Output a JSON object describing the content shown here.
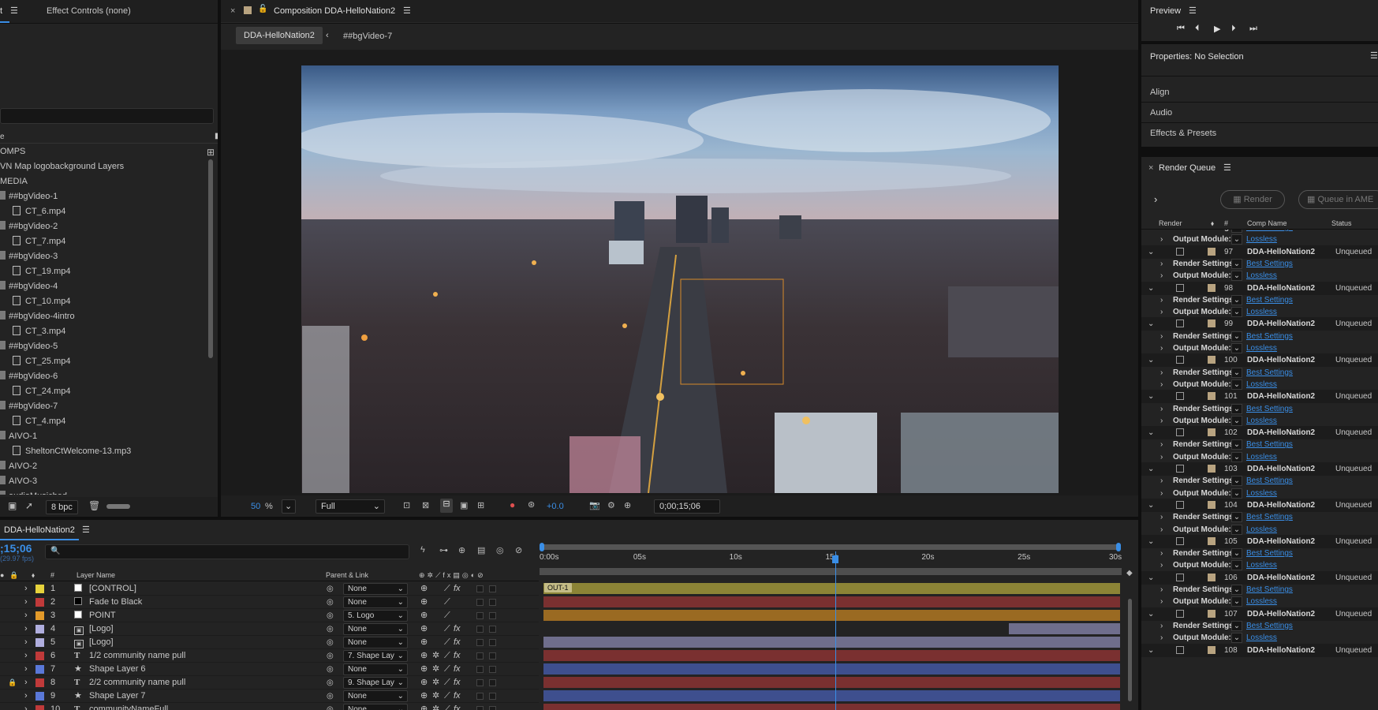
{
  "project": {
    "tab_project_suffix": "t",
    "tab_effect_controls": "Effect Controls (none)",
    "name_header": "e",
    "bpc": "8 bpc",
    "items": [
      {
        "label": "OMPS",
        "type": "folder",
        "indent": 0
      },
      {
        "label": "VN Map logobackground Layers",
        "type": "comp",
        "indent": 0
      },
      {
        "label": "MEDIA",
        "type": "folder",
        "indent": 0
      },
      {
        "label": "##bgVideo-1",
        "type": "folder",
        "indent": 1
      },
      {
        "label": "CT_6.mp4",
        "type": "file",
        "indent": 2
      },
      {
        "label": "##bgVideo-2",
        "type": "folder",
        "indent": 1
      },
      {
        "label": "CT_7.mp4",
        "type": "file",
        "indent": 2
      },
      {
        "label": "##bgVideo-3",
        "type": "folder",
        "indent": 1
      },
      {
        "label": "CT_19.mp4",
        "type": "file",
        "indent": 2
      },
      {
        "label": "##bgVideo-4",
        "type": "folder",
        "indent": 1
      },
      {
        "label": "CT_10.mp4",
        "type": "file",
        "indent": 2
      },
      {
        "label": "##bgVideo-4intro",
        "type": "folder",
        "indent": 1
      },
      {
        "label": "CT_3.mp4",
        "type": "file",
        "indent": 2
      },
      {
        "label": "##bgVideo-5",
        "type": "folder",
        "indent": 1
      },
      {
        "label": "CT_25.mp4",
        "type": "file",
        "indent": 2
      },
      {
        "label": "##bgVideo-6",
        "type": "folder",
        "indent": 1
      },
      {
        "label": "CT_24.mp4",
        "type": "file",
        "indent": 2
      },
      {
        "label": "##bgVideo-7",
        "type": "folder",
        "indent": 1
      },
      {
        "label": "CT_4.mp4",
        "type": "file",
        "indent": 2
      },
      {
        "label": "AIVO-1",
        "type": "folder",
        "indent": 1
      },
      {
        "label": "SheltonCtWelcome-13.mp3",
        "type": "file",
        "indent": 2
      },
      {
        "label": "AIVO-2",
        "type": "folder",
        "indent": 1
      },
      {
        "label": "AIVO-3",
        "type": "folder",
        "indent": 1
      },
      {
        "label": "audioMusicbed",
        "type": "folder",
        "indent": 1
      }
    ]
  },
  "composition": {
    "panel_title": "Composition DDA-HelloNation2",
    "breadcrumb_active": "DDA-HelloNation2",
    "breadcrumb_next": "##bgVideo-7",
    "zoom_value": "50",
    "zoom_unit": "%",
    "resolution": "Full",
    "exposure": "+0.0",
    "timecode": "0;00;15;06"
  },
  "preview": {
    "title": "Preview"
  },
  "properties": {
    "title": "Properties: No Selection",
    "sections": [
      "Align",
      "Audio",
      "Effects & Presets"
    ]
  },
  "render_queue": {
    "title": "Render Queue",
    "render_button": "Render",
    "queue_ame_button": "Queue in AME",
    "columns": {
      "render": "Render",
      "num": "#",
      "comp_name": "Comp Name",
      "status": "Status"
    },
    "render_settings_label": "Render Settings:",
    "output_module_label": "Output Module:",
    "render_settings_value": "Best Settings",
    "output_module_value": "Lossless",
    "items": [
      {
        "num": "97",
        "comp": "DDA-HelloNation2",
        "status": "Unqueued"
      },
      {
        "num": "98",
        "comp": "DDA-HelloNation2",
        "status": "Unqueued"
      },
      {
        "num": "99",
        "comp": "DDA-HelloNation2",
        "status": "Unqueued"
      },
      {
        "num": "100",
        "comp": "DDA-HelloNation2",
        "status": "Unqueued"
      },
      {
        "num": "101",
        "comp": "DDA-HelloNation2",
        "status": "Unqueued"
      },
      {
        "num": "102",
        "comp": "DDA-HelloNation2",
        "status": "Unqueued"
      },
      {
        "num": "103",
        "comp": "DDA-HelloNation2",
        "status": "Unqueued"
      },
      {
        "num": "104",
        "comp": "DDA-HelloNation2",
        "status": "Unqueued"
      },
      {
        "num": "105",
        "comp": "DDA-HelloNation2",
        "status": "Unqueued"
      },
      {
        "num": "106",
        "comp": "DDA-HelloNation2",
        "status": "Unqueued"
      },
      {
        "num": "107",
        "comp": "DDA-HelloNation2",
        "status": "Unqueued"
      },
      {
        "num": "108",
        "comp": "DDA-HelloNation2",
        "status": "Unqueued"
      }
    ]
  },
  "timeline": {
    "comp_tab": "DDA-HelloNation2",
    "timecode": ";15;06",
    "fps": "(29.97 fps)",
    "col_num": "#",
    "col_layer_name": "Layer Name",
    "col_parent": "Parent & Link",
    "ruler": [
      "0:00s",
      "05s",
      "10s",
      "15s",
      "20s",
      "25s",
      "30s"
    ],
    "marker": "OUT-1",
    "playhead_seconds": 15.2,
    "duration_seconds": 30,
    "layers": [
      {
        "num": "1",
        "name": "[CONTROL]",
        "label": "#e6d23c",
        "type": "solid-white",
        "parent": "None",
        "bar": "#8c8436",
        "start": 0,
        "end": 30
      },
      {
        "num": "2",
        "name": "Fade to Black",
        "label": "#c03a3a",
        "type": "solid-black",
        "parent": "None",
        "bar": "#7a3030",
        "start": 0,
        "end": 30
      },
      {
        "num": "3",
        "name": "POINT",
        "label": "#e39a2a",
        "type": "solid-white",
        "parent": "5. Logo",
        "bar": "#9a6a22",
        "start": 0,
        "end": 30
      },
      {
        "num": "4",
        "name": "[Logo]",
        "label": "#b0aede",
        "type": "precomp",
        "parent": "None",
        "bar": "#6f6e8c",
        "start": 24.2,
        "end": 30
      },
      {
        "num": "5",
        "name": "[Logo]",
        "label": "#b0aede",
        "type": "precomp",
        "parent": "None",
        "bar": "#6f6e8c",
        "start": 0,
        "end": 30
      },
      {
        "num": "6",
        "name": "1/2 community name pull",
        "label": "#c03a3a",
        "type": "text",
        "parent": "7. Shape Lay",
        "bar": "#7a3030",
        "start": 0,
        "end": 30
      },
      {
        "num": "7",
        "name": "Shape Layer 6",
        "label": "#5a78d8",
        "type": "shape",
        "parent": "None",
        "bar": "#3e4f8e",
        "start": 0,
        "end": 30
      },
      {
        "num": "8",
        "name": "2/2 community name pull",
        "label": "#c03a3a",
        "type": "text",
        "parent": "9. Shape Lay",
        "bar": "#7a3030",
        "start": 0,
        "end": 30
      },
      {
        "num": "9",
        "name": "Shape Layer 7",
        "label": "#5a78d8",
        "type": "shape",
        "parent": "None",
        "bar": "#3e4f8e",
        "start": 0,
        "end": 30
      },
      {
        "num": "10",
        "name": "communityNameFull",
        "label": "#c03a3a",
        "type": "text",
        "parent": "None",
        "bar": "#7a3030",
        "start": 0,
        "end": 30
      }
    ]
  }
}
